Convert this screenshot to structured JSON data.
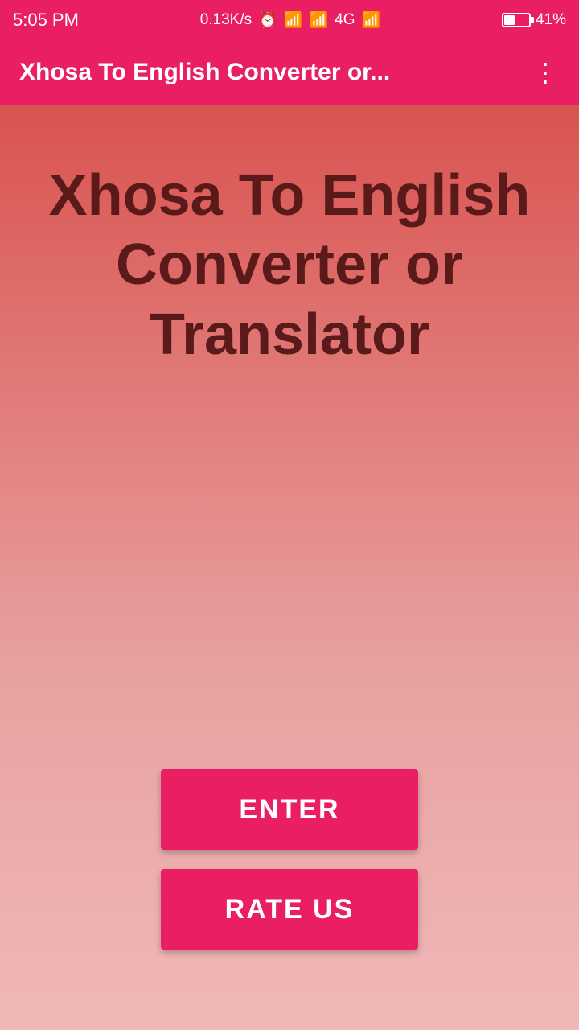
{
  "status_bar": {
    "time": "5:05 PM",
    "network_speed": "0.13K/s",
    "signal_4g": "4G",
    "battery_percent": "41%"
  },
  "app_bar": {
    "title": "Xhosa To English Converter or...",
    "more_icon_label": "⋮"
  },
  "main": {
    "hero_title": "Xhosa To English Converter or Translator",
    "enter_button_label": "ENTER",
    "rate_us_button_label": "RATE US"
  }
}
